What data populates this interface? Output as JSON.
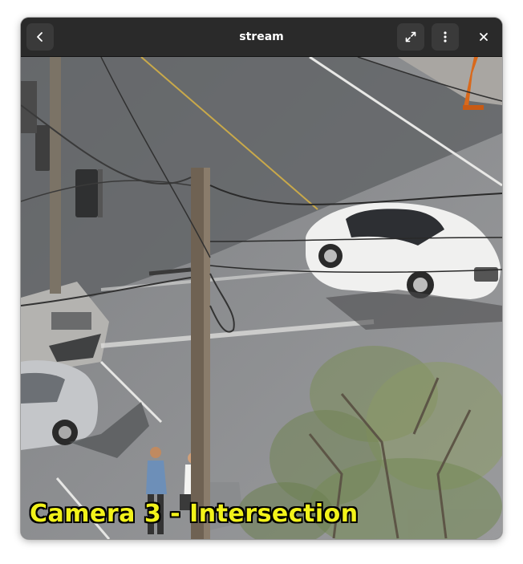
{
  "window": {
    "title": "stream"
  },
  "header": {
    "back_icon": "chevron-left-icon",
    "expand_icon": "expand-arrows-icon",
    "menu_icon": "vertical-dots-icon",
    "close_icon": "close-icon"
  },
  "video": {
    "overlay_text": "Camera 3 - Intersection",
    "overlay_color": "#f2f21a"
  }
}
